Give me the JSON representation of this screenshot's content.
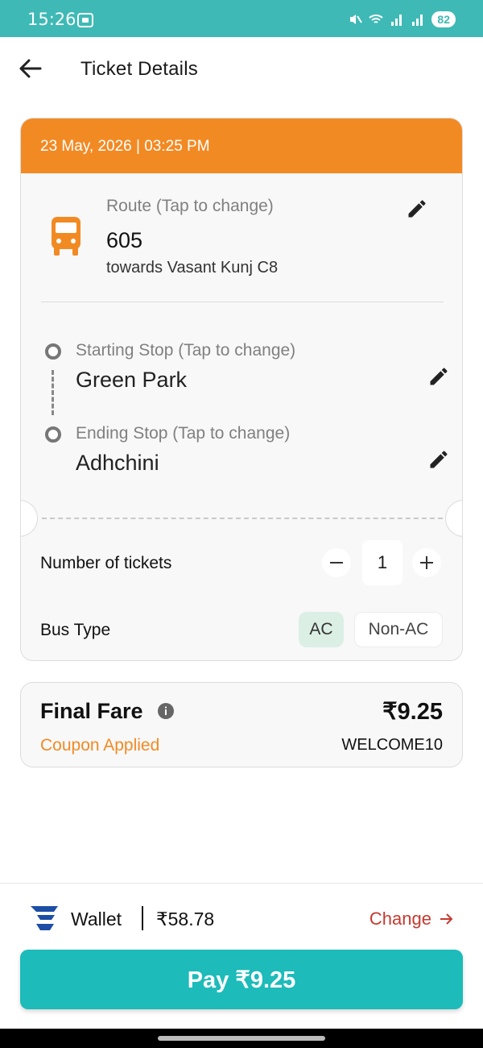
{
  "status_bar": {
    "time": "15:26",
    "battery": "82"
  },
  "header": {
    "title": "Ticket Details"
  },
  "ticket": {
    "datetime": "23 May, 2026 | 03:25 PM",
    "route_label": "Route (Tap to change)",
    "route_number": "605",
    "route_direction": "towards Vasant Kunj C8",
    "start_label": "Starting Stop (Tap to change)",
    "start_stop": "Green Park",
    "end_label": "Ending Stop (Tap to change)",
    "end_stop": "Adhchini",
    "tickets_label": "Number of tickets",
    "ticket_count": "1",
    "bus_type_label": "Bus Type",
    "bus_types": [
      "AC",
      "Non-AC"
    ],
    "selected_bus_type": "AC"
  },
  "fare": {
    "title": "Final Fare",
    "amount": "₹9.25",
    "coupon_label": "Coupon Applied",
    "coupon_code": "WELCOME10"
  },
  "wallet": {
    "label": "Wallet",
    "balance": "₹58.78",
    "change_label": "Change"
  },
  "pay_button": {
    "label": "Pay ₹9.25"
  },
  "colors": {
    "accent_orange": "#f28a24",
    "teal": "#1dbbb9",
    "status_bar": "#3fb9b5",
    "change_red": "#c6392f",
    "ac_selected": "#dbefe5"
  }
}
